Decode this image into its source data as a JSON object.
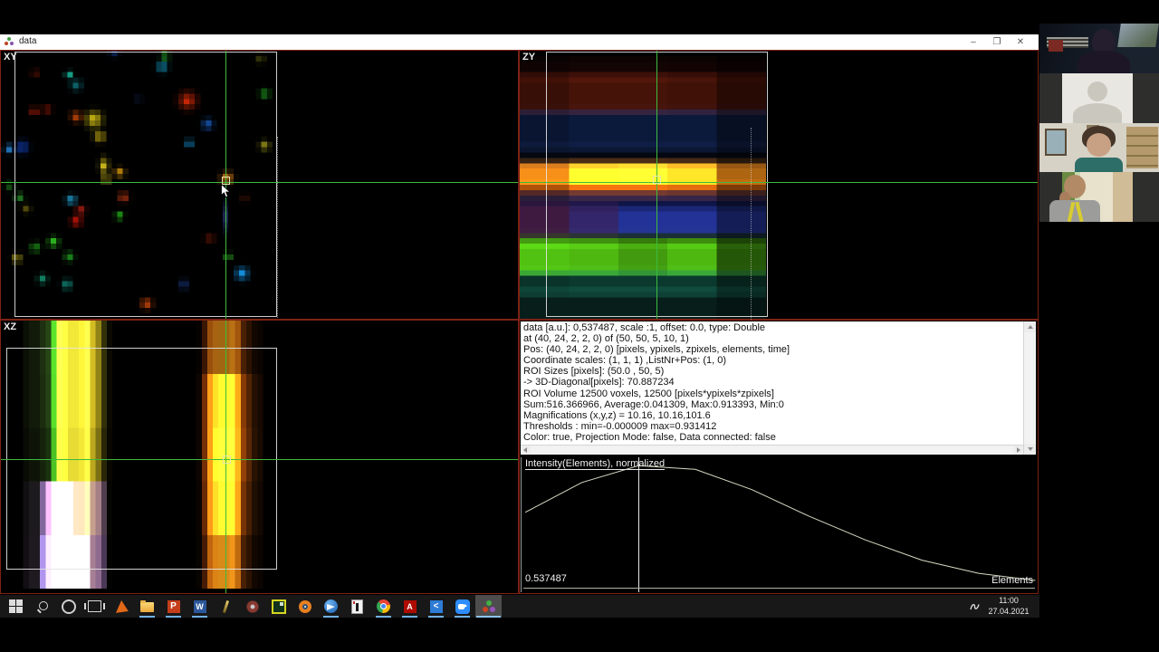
{
  "window": {
    "title": "data",
    "controls": {
      "minimize": "–",
      "maximize": "❐",
      "close": "✕"
    }
  },
  "panels": {
    "xy_label": "XY",
    "zy_label": "ZY",
    "xz_label": "XZ",
    "xy_blobs": [
      [
        13.6,
        6.4,
        2,
        "#18c8d8",
        0.55
      ],
      [
        3.9,
        18,
        2.2,
        "#1858ff",
        0.8
      ],
      [
        1.5,
        18.3,
        1.6,
        "#30a0ff",
        0.9
      ],
      [
        12.3,
        4.5,
        1.4,
        "#20e0c0",
        0.95
      ],
      [
        29.1,
        3,
        2,
        "#18b8e8",
        0.9
      ],
      [
        29.6,
        1,
        1.6,
        "#30d830",
        0.8
      ],
      [
        20.4,
        0.3,
        1.8,
        "#2050c0",
        0.5
      ],
      [
        33.7,
        9.3,
        3,
        "#f03008",
        1
      ],
      [
        37.3,
        13.7,
        2,
        "#2070e8",
        0.85
      ],
      [
        34,
        17.3,
        1.5,
        "#18a8f0",
        0.9
      ],
      [
        47.6,
        8,
        1.8,
        "#28c828",
        0.8
      ],
      [
        47.6,
        17.7,
        1.8,
        "#c8c020",
        0.8
      ],
      [
        46.8,
        1.5,
        1.6,
        "#909018",
        0.5
      ],
      [
        8.3,
        11,
        1.8,
        "#d02008",
        0.6
      ],
      [
        6,
        11.3,
        1.5,
        "#f02808",
        0.8
      ],
      [
        13.6,
        12.3,
        2,
        "#f05808",
        0.85
      ],
      [
        16.8,
        12.8,
        2.8,
        "#ffe818",
        1
      ],
      [
        17.8,
        16,
        2,
        "#f8d818",
        0.9
      ],
      [
        18.6,
        21.5,
        1.6,
        "#f8e020",
        0.9,
        1,
        1.8
      ],
      [
        21.4,
        22.7,
        1.8,
        "#f8b010",
        0.9
      ],
      [
        22.1,
        27.3,
        1.8,
        "#f04818",
        0.85
      ],
      [
        19,
        24,
        1.5,
        "#e8d020",
        0.85
      ],
      [
        40.8,
        23.8,
        2.2,
        "#f89018",
        1
      ],
      [
        1.6,
        25.3,
        1.6,
        "#28a028",
        0.6
      ],
      [
        3.3,
        27.3,
        1.6,
        "#38c838",
        0.8
      ],
      [
        12.7,
        27.8,
        1.9,
        "#28b8f0",
        0.95
      ],
      [
        14.4,
        29.8,
        1.7,
        "#e82818",
        0.85
      ],
      [
        13.6,
        31.8,
        1.9,
        "#f81808",
        0.95
      ],
      [
        21.4,
        30.8,
        1.5,
        "#30e020",
        0.95
      ],
      [
        4.6,
        29.5,
        1.6,
        "#b8a818",
        0.5
      ],
      [
        6.2,
        36.7,
        1.8,
        "#28c020",
        0.8
      ],
      [
        9.5,
        35.7,
        1.9,
        "#38e828",
        0.95
      ],
      [
        12.3,
        38.4,
        1.8,
        "#28c028",
        0.85
      ],
      [
        2.9,
        38.7,
        1.7,
        "#d8c818",
        0.8
      ],
      [
        7.5,
        42.6,
        1.8,
        "#18b088",
        0.8
      ],
      [
        11.9,
        43.6,
        1.8,
        "#18c8b0",
        0.85
      ],
      [
        37.7,
        35,
        1.8,
        "#c02808",
        0.55
      ],
      [
        41,
        38.4,
        1.4,
        "#38d828",
        0.85
      ],
      [
        43.5,
        41.6,
        2.4,
        "#18a0f8",
        0.95
      ],
      [
        33,
        43.6,
        1.8,
        "#2858c8",
        0.6
      ],
      [
        26.3,
        47.2,
        2,
        "#f85808",
        0.95
      ],
      [
        6.2,
        4.2,
        1.4,
        "#c82808",
        0.5
      ],
      [
        40.6,
        31,
        0.9,
        "#3848a0",
        0.7,
        1,
        6
      ],
      [
        24.8,
        9,
        1.5,
        "#203878",
        0.45
      ],
      [
        44,
        27.5,
        1.6,
        "#802808",
        0.45
      ]
    ],
    "zy_bands": [
      [
        2,
        5,
        "#200806",
        0.6,
        [
          0.8,
          1,
          1,
          0.9,
          0.5
        ]
      ],
      [
        5,
        11,
        "#4a1408",
        0.95,
        [
          0.8,
          1,
          1,
          0.9,
          0.55
        ]
      ],
      [
        11.5,
        18,
        "#0c1a3e",
        0.95,
        [
          0.85,
          1,
          1,
          1,
          0.6
        ]
      ],
      [
        18,
        21,
        "#060a14",
        0.8,
        [
          1,
          1,
          1,
          1,
          0.6
        ]
      ],
      [
        21.3,
        25,
        "#e87810",
        1,
        [
          0.72,
          1,
          1,
          0.95,
          0.5
        ]
      ],
      [
        22,
        24.2,
        "#ffb828",
        0.9,
        [
          0.35,
          0.85,
          1,
          0.7,
          0.25
        ]
      ],
      [
        25,
        26.8,
        "#903c06",
        0.75,
        [
          0.7,
          1,
          1,
          0.9,
          0.5
        ]
      ],
      [
        27,
        34,
        "#10164a",
        0.95,
        [
          0.8,
          1,
          1,
          1,
          0.6
        ]
      ],
      [
        29,
        34,
        "#380a0a",
        0.9,
        [
          1,
          0.55,
          0,
          0,
          0
        ]
      ],
      [
        30,
        33.5,
        "#1c2a72",
        0.7,
        [
          0,
          0.4,
          1,
          1,
          0.55
        ]
      ],
      [
        34.5,
        36,
        "#1a3808",
        0.7,
        [
          1,
          0.9,
          0.8,
          0.8,
          0.4
        ]
      ],
      [
        36,
        41,
        "#52c212",
        1,
        [
          1,
          0.95,
          0.8,
          0.95,
          0.45
        ]
      ],
      [
        41.5,
        45,
        "#0c3c30",
        0.95,
        [
          0.9,
          1,
          1,
          1,
          0.6
        ]
      ],
      [
        45,
        49.5,
        "#08201c",
        0.95,
        [
          1,
          1,
          1,
          1,
          0.7
        ]
      ]
    ],
    "xz_stripes": [
      [
        5,
        8,
        "#1c2a10",
        0.7,
        [
          0.9,
          0.9,
          0.7,
          0.5,
          0.4
        ]
      ],
      [
        8,
        10,
        "#1a3010",
        0.75,
        [
          1,
          0.9,
          0.6,
          0.4,
          0.3
        ]
      ],
      [
        9.5,
        10.8,
        "#46c020",
        1,
        [
          1,
          1,
          0.9,
          0.55,
          0.35
        ]
      ],
      [
        10.8,
        15.5,
        "#f2e838",
        1,
        [
          1,
          1,
          0.95,
          0.62,
          0.4
        ]
      ],
      [
        15.5,
        17,
        "#b8a01c",
        0.85,
        [
          1,
          1,
          0.9,
          0.5,
          0.3
        ]
      ],
      [
        17,
        18.6,
        "#3c3a0a",
        0.85,
        [
          1,
          1,
          0.8,
          0.5,
          0.3
        ]
      ],
      [
        36.5,
        37.8,
        "#7a3008",
        0.95,
        [
          0.5,
          1,
          1,
          0.9,
          0.6
        ]
      ],
      [
        37.8,
        42.2,
        "#ef8e14",
        1,
        [
          0.5,
          1,
          1,
          1,
          0.65
        ]
      ],
      [
        39,
        41.5,
        "#ffc232",
        0.8,
        [
          0.2,
          0.7,
          1,
          0.7,
          0.3
        ]
      ],
      [
        42.2,
        43.8,
        "#8a3c08",
        0.9,
        [
          0.5,
          0.9,
          1,
          0.8,
          0.5
        ]
      ],
      [
        44,
        46,
        "#401c04",
        0.7,
        [
          0.4,
          0.8,
          0.9,
          0.7,
          0.4
        ]
      ],
      [
        5,
        8,
        "#201428",
        0.7,
        [
          0,
          0,
          0,
          0.8,
          1
        ]
      ],
      [
        7.8,
        18,
        "#6a4890",
        0.95,
        [
          0,
          0,
          0,
          0.9,
          1
        ]
      ],
      [
        8.5,
        12.5,
        "#b06078",
        0.85,
        [
          0,
          0,
          0,
          0.9,
          0.5
        ]
      ],
      [
        8,
        15,
        "#7880c8",
        0.75,
        [
          0,
          0,
          0,
          0.2,
          1
        ]
      ]
    ]
  },
  "info_panel": {
    "lines": [
      "data [a.u.]: 0,537487, scale :1, offset: 0.0, type: Double",
      "at (40, 24, 2, 2, 0) of (50, 50, 5, 10, 1)",
      "Pos: (40, 24, 2, 2, 0) [pixels, ypixels, zpixels, elements, time]",
      "Coordinate scales: (1, 1, 1)  ,ListNr+Pos: (1, 0)",
      "ROI Sizes [pixels]: (50.0  , 50, 5)",
      " -> 3D-Diagonal[pixels]: 70.887234",
      "ROI Volume 12500 voxels, 12500 [pixels*ypixels*zpixels]",
      "Sum:516.366966, Average:0.041309, Max:0.913393, Min:0",
      "Magnifications (x,y,z) = 10.16, 10.16,101.6",
      "Thresholds : min=-0.000009 max=0.931412",
      "Color: true, Projection Mode: false, Data connected: false"
    ]
  },
  "plot": {
    "title": "Intensity(Elements), normalized",
    "current_value": "0.537487",
    "x_axis_label": "Elements",
    "chart_data": {
      "type": "line",
      "title": "Intensity(Elements), normalized",
      "xlabel": "Elements",
      "x": [
        0,
        1,
        2,
        3,
        4,
        5,
        6,
        7,
        8,
        9
      ],
      "values": [
        0.6,
        0.85,
        0.99,
        0.96,
        0.79,
        0.57,
        0.37,
        0.2,
        0.09,
        0.03
      ],
      "marker_x": 2,
      "ylim": [
        0,
        1
      ],
      "grid": false,
      "legend": false
    }
  },
  "taskbar": {
    "items": [
      {
        "name": "start",
        "open": false,
        "active": false
      },
      {
        "name": "search",
        "open": false,
        "active": false
      },
      {
        "name": "cortana",
        "open": false,
        "active": false
      },
      {
        "name": "task-view",
        "open": false,
        "active": false
      },
      {
        "name": "matlab",
        "open": false,
        "active": false
      },
      {
        "name": "file-explorer",
        "open": true,
        "active": false
      },
      {
        "name": "powerpoint",
        "open": true,
        "active": false
      },
      {
        "name": "word",
        "open": true,
        "active": false
      },
      {
        "name": "stylus",
        "open": false,
        "active": false
      },
      {
        "name": "gear-app",
        "open": false,
        "active": false
      },
      {
        "name": "capture-app",
        "open": false,
        "active": false
      },
      {
        "name": "blender",
        "open": false,
        "active": false
      },
      {
        "name": "thunderbird",
        "open": true,
        "active": false
      },
      {
        "name": "viewer-app",
        "open": false,
        "active": false
      },
      {
        "name": "chrome",
        "open": true,
        "active": false
      },
      {
        "name": "acrobat",
        "open": true,
        "active": false
      },
      {
        "name": "vscode",
        "open": true,
        "active": false
      },
      {
        "name": "zoom-app",
        "open": true,
        "active": false
      },
      {
        "name": "data-viewer",
        "open": true,
        "active": true
      }
    ],
    "clock": {
      "time": "11:00",
      "date": "27.04.2021"
    }
  },
  "sidebar": {
    "participants": [
      {
        "id": "participant-1",
        "type": "video"
      },
      {
        "id": "participant-2",
        "type": "avatar-placeholder"
      },
      {
        "id": "participant-3",
        "type": "video"
      },
      {
        "id": "participant-4",
        "type": "video"
      }
    ]
  },
  "colors": {
    "crosshair": "#3dbb3d",
    "roi_outline": "#e4e4e4",
    "panel_border": "#7e2214",
    "taskbar_underline": "#72b2e4",
    "info_background": "#ffffff",
    "plot_curve": "#d8d8c4"
  }
}
